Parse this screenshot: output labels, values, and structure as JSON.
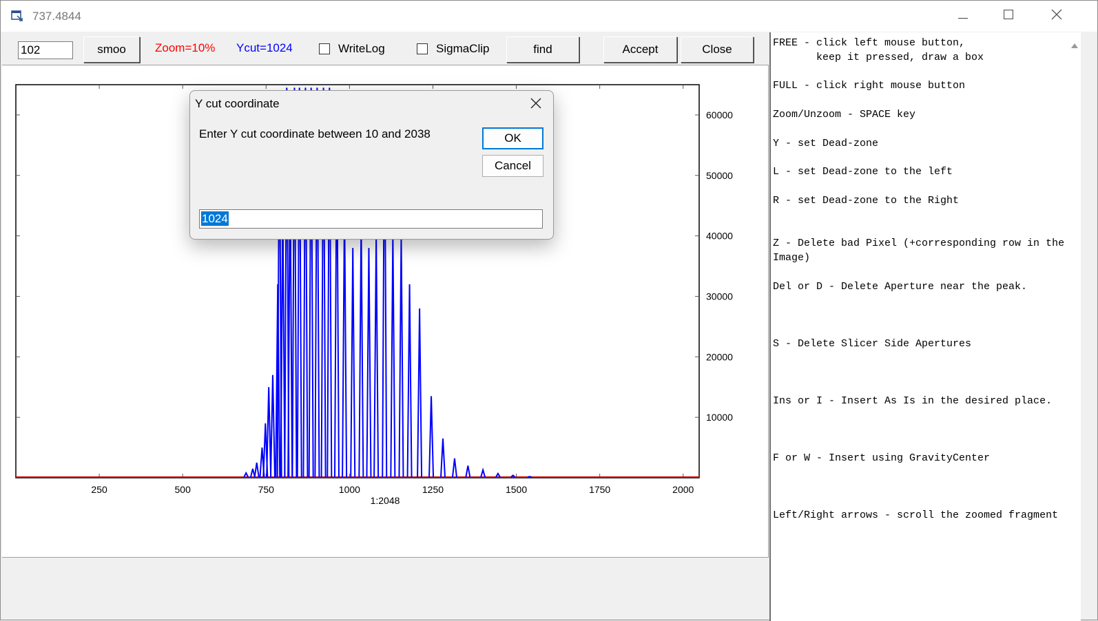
{
  "window": {
    "title": "737.4844"
  },
  "toolbar": {
    "value_input": "102",
    "smooth_label": "smoo",
    "zoom_label": "Zoom=10%",
    "ycut_label": "Ycut=1024",
    "writelog_label": "WriteLog",
    "sigmaclip_label": "SigmaClip",
    "find_label": "find",
    "accept_label": "Accept",
    "close_label": "Close",
    "writelog_checked": false,
    "sigmaclip_checked": false,
    "zoom_color": "#ff0000",
    "ycut_color": "#0000ff"
  },
  "dialog": {
    "title": "Y cut coordinate",
    "prompt": "Enter Y cut coordinate between 10 and 2038",
    "ok_label": "OK",
    "cancel_label": "Cancel",
    "input_value": "1024"
  },
  "help_text": "FREE - click left mouse button,\n       keep it pressed, draw a box\n\nFULL - click right mouse button\n\nZoom/Unzoom - SPACE key\n\nY - set Dead-zone\n\nL - set Dead-zone to the left\n\nR - set Dead-zone to the Right\n\n\nZ - Delete bad Pixel (+corresponding row in the Image)\n\nDel or D - Delete Aperture near the peak.\n\n\n\nS - Delete Slicer Side Apertures\n\n\n\nIns or I - Insert As Is in the desired place.\n\n\n\nF or W - Insert using GravityCenter\n\n\n\nLeft/Right arrows - scroll the zoomed fragment",
  "chart_data": {
    "type": "line",
    "xlabel": "1:2048",
    "ylabel": "",
    "xlim": [
      0,
      2048
    ],
    "ylim": [
      0,
      65000
    ],
    "xticks": [
      250,
      500,
      750,
      1000,
      1250,
      1500,
      1750,
      2000
    ],
    "yticks": [
      10000,
      20000,
      30000,
      40000,
      50000,
      60000
    ],
    "y_axis_side": "right",
    "series_color": "#0000ff",
    "baseline_color": "#cc0000",
    "peaks": [
      {
        "x": 690,
        "y": 800
      },
      {
        "x": 710,
        "y": 1500
      },
      {
        "x": 722,
        "y": 2500
      },
      {
        "x": 738,
        "y": 5000
      },
      {
        "x": 748,
        "y": 9000
      },
      {
        "x": 758,
        "y": 15000
      },
      {
        "x": 770,
        "y": 17000
      },
      {
        "x": 785,
        "y": 32000
      },
      {
        "x": 790,
        "y": 62000
      },
      {
        "x": 800,
        "y": 45000
      },
      {
        "x": 812,
        "y": 64500
      },
      {
        "x": 822,
        "y": 51000
      },
      {
        "x": 835,
        "y": 64500
      },
      {
        "x": 850,
        "y": 64500
      },
      {
        "x": 868,
        "y": 64500
      },
      {
        "x": 885,
        "y": 64500
      },
      {
        "x": 903,
        "y": 64500
      },
      {
        "x": 922,
        "y": 64500
      },
      {
        "x": 940,
        "y": 64500
      },
      {
        "x": 962,
        "y": 58000
      },
      {
        "x": 985,
        "y": 45000
      },
      {
        "x": 1010,
        "y": 38000
      },
      {
        "x": 1035,
        "y": 42000
      },
      {
        "x": 1058,
        "y": 38000
      },
      {
        "x": 1080,
        "y": 40000
      },
      {
        "x": 1105,
        "y": 63000
      },
      {
        "x": 1130,
        "y": 40000
      },
      {
        "x": 1155,
        "y": 40000
      },
      {
        "x": 1180,
        "y": 32000
      },
      {
        "x": 1210,
        "y": 28000
      },
      {
        "x": 1245,
        "y": 13500
      },
      {
        "x": 1280,
        "y": 6500
      },
      {
        "x": 1315,
        "y": 3200
      },
      {
        "x": 1355,
        "y": 2000
      },
      {
        "x": 1400,
        "y": 1300
      },
      {
        "x": 1445,
        "y": 700
      },
      {
        "x": 1490,
        "y": 400
      },
      {
        "x": 1540,
        "y": 200
      }
    ]
  }
}
